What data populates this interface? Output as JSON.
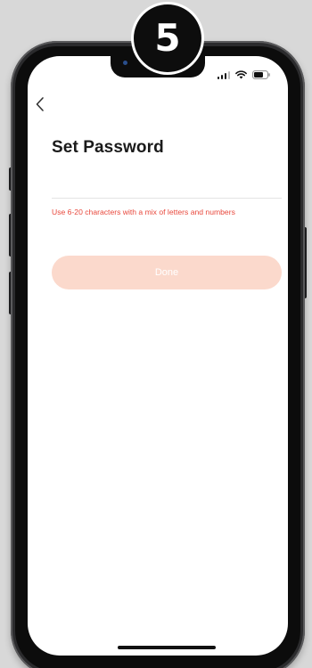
{
  "step": {
    "number": "5"
  },
  "screen": {
    "title": "Set Password",
    "password_field": {
      "value": "",
      "placeholder": ""
    },
    "hint": "Use 6-20 characters with a mix of letters and numbers",
    "done_label": "Done"
  },
  "status_bar": {
    "icons": [
      "signal-icon",
      "wifi-icon",
      "battery-icon"
    ]
  },
  "colors": {
    "accent_light": "#fbd9cc",
    "hint_text": "#e8483c",
    "background": "#ffffff"
  }
}
